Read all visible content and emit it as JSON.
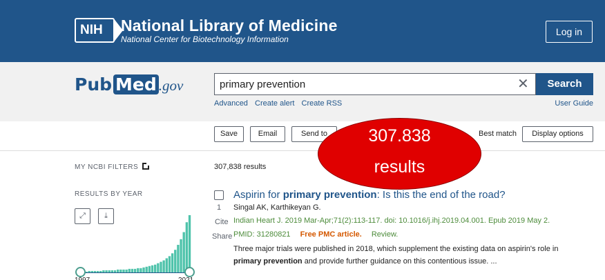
{
  "header": {
    "logo_text": "NIH",
    "title": "National Library of Medicine",
    "subtitle": "National Center for Biotechnology Information",
    "login_label": "Log in"
  },
  "search": {
    "logo": {
      "pub": "Pub",
      "med": "Med",
      "gov": ".gov"
    },
    "query": "primary prevention",
    "clear_icon": "close-icon",
    "button_label": "Search",
    "links": [
      "Advanced",
      "Create alert",
      "Create RSS"
    ],
    "user_guide": "User Guide"
  },
  "toolbar": {
    "save": "Save",
    "email": "Email",
    "send_to": "Send to",
    "sort_label": "Best match",
    "display_options": "Display options"
  },
  "sidebar": {
    "filters_label": "MY NCBI FILTERS",
    "results_by_year": "RESULTS BY YEAR",
    "expand_icon": "expand-icon",
    "download_icon": "download-icon",
    "year_start": "1997",
    "year_end": "2021",
    "histogram": [
      2,
      2,
      2,
      3,
      3,
      3,
      3,
      3,
      4,
      4,
      4,
      4,
      4,
      5,
      5,
      5,
      5,
      6,
      6,
      6,
      7,
      7,
      8,
      9,
      10,
      11,
      12,
      14,
      16,
      18,
      21,
      24,
      28,
      33,
      40,
      48,
      58,
      72,
      82
    ]
  },
  "results": {
    "count_text": "307,838 results",
    "items": [
      {
        "number": "1",
        "title_pre": "Aspirin for ",
        "title_bold": "primary prevention",
        "title_post": ": Is this the end of the road?",
        "authors": "Singal AK, Karthikeyan G.",
        "journal": "Indian Heart J. 2019 Mar-Apr;71(2):113-117. doi: 10.1016/j.ihj.2019.04.001. Epub 2019 May 2.",
        "pmid": "PMID: 31280821",
        "free": "Free PMC article.",
        "type": "Review.",
        "snippet_pre": "Three major trials were published in 2018, which supplement the existing data on aspirin's role in ",
        "snippet_bold": "primary prevention",
        "snippet_post": " and provide further guidance on this contentious issue. ...",
        "cite_label": "Cite",
        "share_label": "Share"
      }
    ]
  },
  "overlay": {
    "line1": "307.838",
    "line2": "results",
    "color": "#e00000"
  }
}
